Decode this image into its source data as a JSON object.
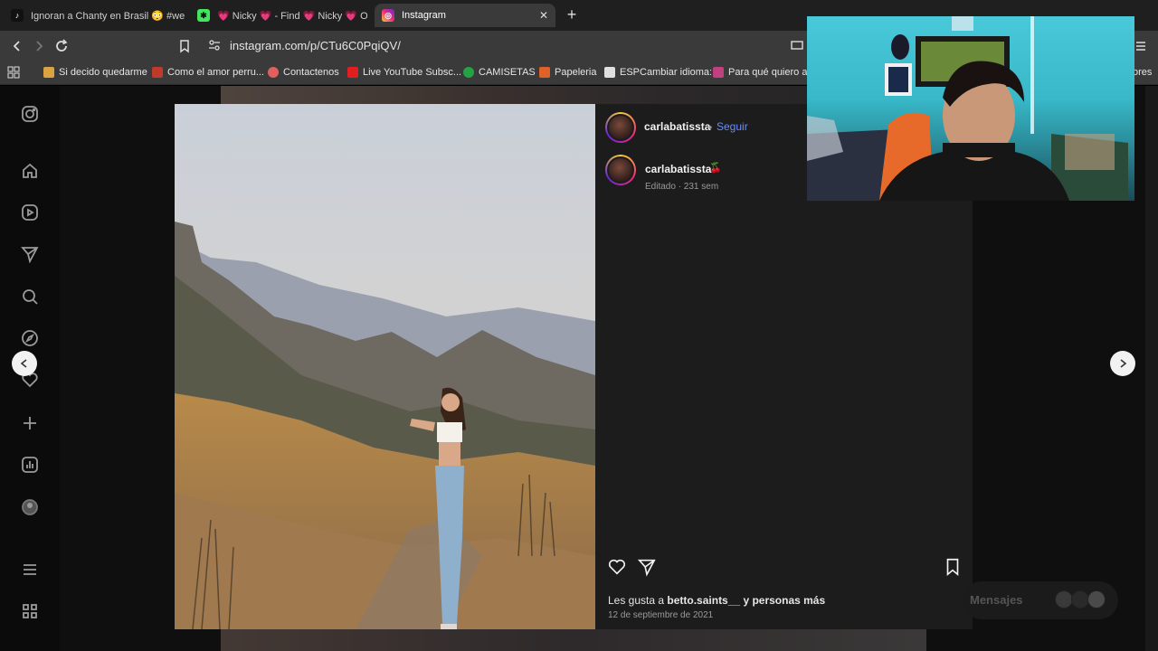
{
  "browser": {
    "tabs": [
      {
        "title": "Ignoran a Chanty en Brasil 😳 #west",
        "icon": "tiktok-icon",
        "active": false
      },
      {
        "title": "💗 Nicky 💗 - Find 💗 Nicky 💗 On",
        "icon": "linktree-icon",
        "active": false
      },
      {
        "title": "Instagram",
        "icon": "instagram-icon",
        "active": true
      }
    ],
    "url": "instagram.com/p/CTu6C0PqiQV/",
    "bookmarks": [
      {
        "label": "Si decido quedarme",
        "color": "#d9a441"
      },
      {
        "label": "Como el amor perru...",
        "color": "#c0392b"
      },
      {
        "label": "Contactenos",
        "color": "#e06060"
      },
      {
        "label": "Live YouTube Subsc...",
        "color": "#e02020"
      },
      {
        "label": "CAMISETAS",
        "color": "#25a244"
      },
      {
        "label": "Papeleria",
        "color": "#e0602a"
      },
      {
        "label": "ESPCambiar idioma:",
        "color": "#e0e0e0"
      },
      {
        "label": "Para qué quiero asp",
        "color": "#c04080"
      },
      {
        "label": "ores",
        "color": ""
      }
    ]
  },
  "post": {
    "username": "carlabatissta",
    "follow_label": "Seguir",
    "separator": "•",
    "caption_username": "carlabatissta",
    "caption_emoji": "🍒",
    "edited_label": "Editado · 231 sem",
    "likes_prefix": "Les gusta a",
    "likes_user": "betto.saints__",
    "likes_suffix": "y personas más",
    "date": "12 de septiembre de 2021"
  },
  "messages": {
    "label": "Mensajes"
  }
}
